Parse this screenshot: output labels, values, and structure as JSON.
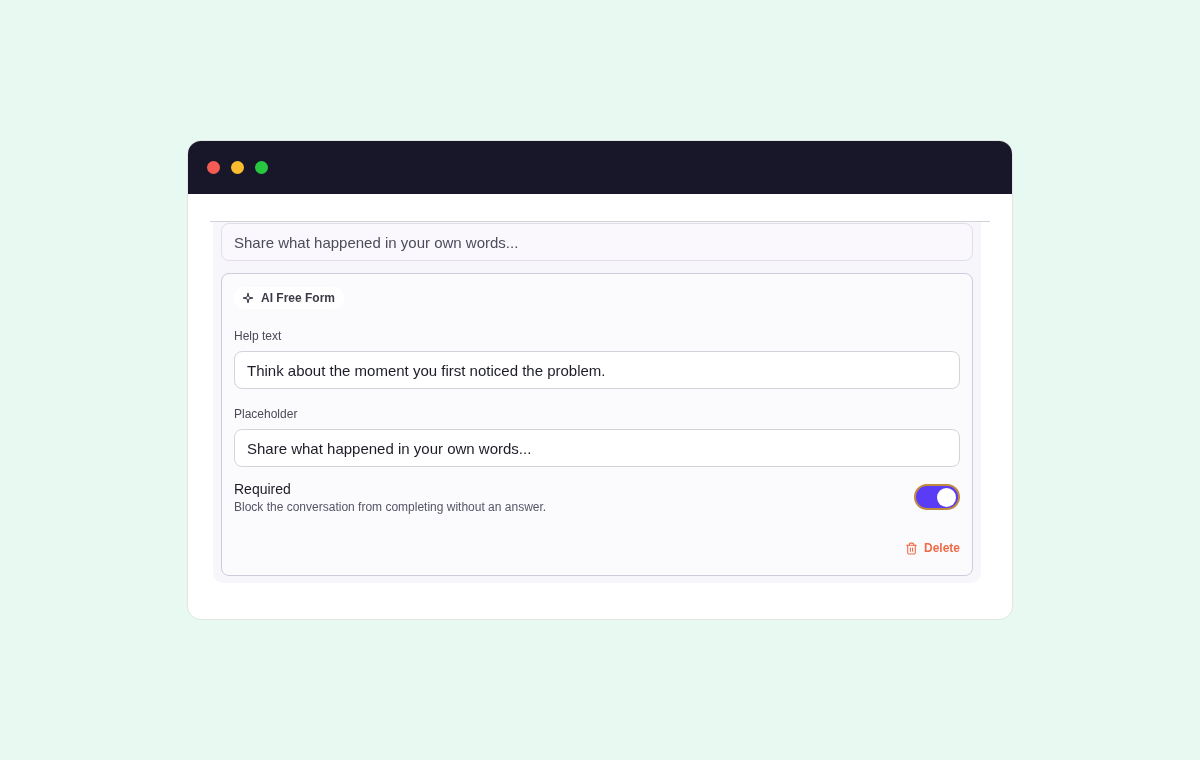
{
  "window": {
    "controls": [
      {
        "color": "#f25c54"
      },
      {
        "color": "#fbbc2e"
      },
      {
        "color": "#27c840"
      }
    ]
  },
  "preview": {
    "placeholder": "Share what happened in your own words..."
  },
  "editor": {
    "badge": "AI Free Form",
    "fields": [
      {
        "label": "Help text",
        "value": "Think about the moment you first noticed the problem."
      },
      {
        "label": "Placeholder",
        "value": "Share what happened in your own words..."
      }
    ],
    "required": {
      "label": "Required",
      "description": "Block the conversation from completing without an answer.",
      "on": true
    },
    "delete_button": "Delete"
  }
}
